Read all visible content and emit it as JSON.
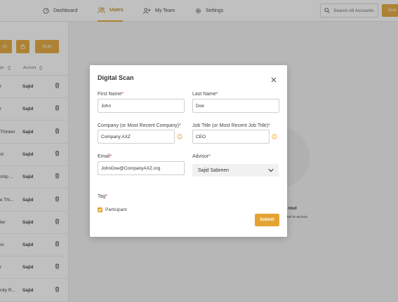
{
  "nav": {
    "items": [
      {
        "label": "Dashboard",
        "icon": "dashboard-icon"
      },
      {
        "label": "Users",
        "icon": "users-icon",
        "active": true
      },
      {
        "label": "My Team",
        "icon": "add-user-icon"
      },
      {
        "label": "Settings",
        "icon": "gear-icon"
      }
    ],
    "search_placeholder": "Search All Accounts",
    "search_button_label": "Sear"
  },
  "left_panel": {
    "buttons": {
      "first": "ch",
      "second": "Scan"
    },
    "headers": {
      "col1": "pe",
      "col2": "Account"
    },
    "rows": [
      {
        "name": "r",
        "advisor": "Sajid"
      },
      {
        "name": "r",
        "advisor": "Sajid"
      },
      {
        "name": "Thinker",
        "advisor": "Sajid"
      },
      {
        "name": "st",
        "advisor": "Sajid"
      },
      {
        "name": "ship ...",
        "advisor": "Sajid"
      },
      {
        "name": "e Thi...",
        "advisor": "Sajid"
      },
      {
        "name": "ter",
        "advisor": "Sajid"
      },
      {
        "name": "or",
        "advisor": "Sajid"
      },
      {
        "name": "r",
        "advisor": "Sajid"
      },
      {
        "name": "nity R...",
        "advisor": "Sajid"
      }
    ]
  },
  "background": {
    "status_title": "nted",
    "status_subtitle": "anel to access"
  },
  "modal": {
    "title": "Digital Scan",
    "first_name_label": "First Name",
    "first_name_value": "John",
    "last_name_label": "Last Name",
    "last_name_value": "Doe",
    "company_label": "Company (or Most Recent Company)",
    "company_value": "Company AXZ",
    "job_title_label": "Job Title (or Most Recent Job Title)",
    "job_title_value": "CEO",
    "email_label": "Email",
    "email_value": "JohnDoe@CompanyAXZ.org",
    "advisor_label": "Advisor",
    "advisor_value": "Sajid Sabreen",
    "tag_label": "Tag",
    "participant_label": "Participant",
    "participant_checked": true,
    "submit_label": "Submit",
    "required_marker": "*"
  },
  "colors": {
    "accent": "#e3a432",
    "required": "#d0342c"
  }
}
